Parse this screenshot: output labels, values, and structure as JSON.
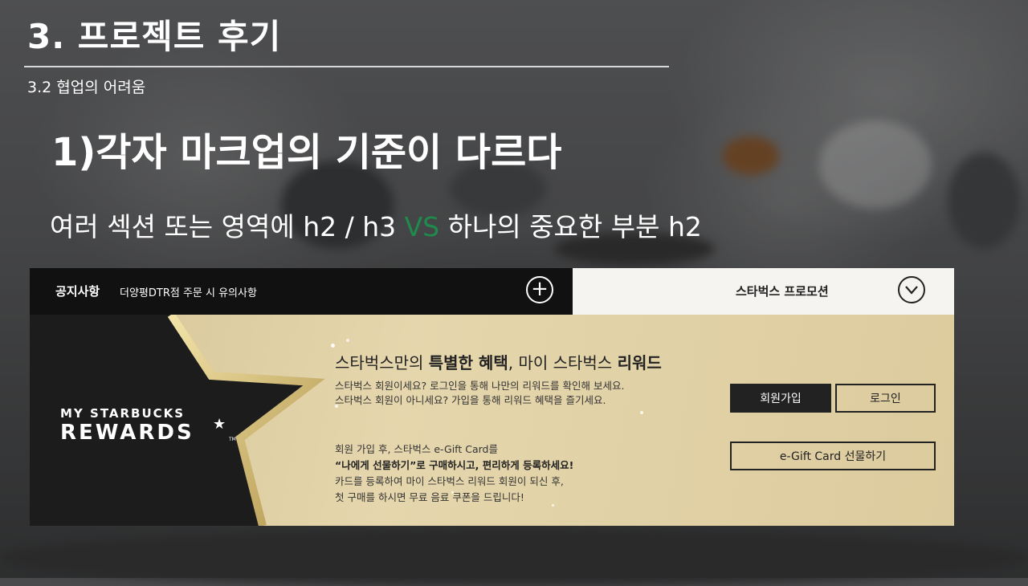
{
  "slide": {
    "title": "3. 프로젝트 후기",
    "subsection": "3.2  협업의 어려움",
    "heading": "1)각자 마크업의 기준이 다르다",
    "desc_before": "여러 섹션 또는 영역에 h2 / h3  ",
    "desc_vs": "VS",
    "desc_after": " 하나의 중요한 부분 h2",
    "colors": {
      "vs": "#1e8a4c",
      "title": "#ffffff"
    }
  },
  "screenshot": {
    "notice": {
      "label": "공지사항",
      "text": "더양평DTR점 주문 시 유의사항",
      "plus_icon": "plus-circle-icon"
    },
    "promo": {
      "label": "스타벅스 프로모션",
      "chevron_icon": "chevron-down-icon"
    },
    "rewards": {
      "logo_line1": "MY STARBUCKS",
      "logo_line2": "REWARDS",
      "logo_star": "★",
      "logo_tm": "TM",
      "heading_prefix": "스타벅스만의 ",
      "heading_bold1": "특별한 혜택",
      "heading_mid": ", 마이 스타벅스 ",
      "heading_bold2": "리워드",
      "line1": "스타벅스 회원이세요? 로그인을 통해  나만의 리워드를 확인해 보세요.",
      "line2": "스타벅스 회원이 아니세요? 가입을 통해 리워드 혜택을 즐기세요.",
      "line3": "회원 가입 후, 스타벅스 e-Gift Card를",
      "line4": "“나에게 선물하기”로 구매하시고, 편리하게 등록하세요!",
      "line5": "카드를 등록하여 마이 스타벅스 리워드 회원이 되신 후,",
      "line6": "첫 구매를 하시면 무료 음료 쿠폰을 드립니다!",
      "join_label": "회원가입",
      "login_label": "로그인",
      "gift_label": "e-Gift Card 선물하기"
    }
  }
}
